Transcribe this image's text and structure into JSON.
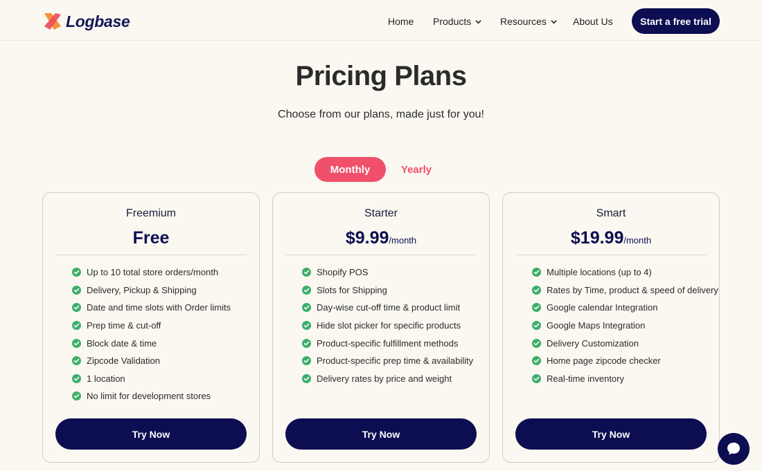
{
  "brand": {
    "name": "Logbase",
    "colors": {
      "logo_orange": "#f7923a",
      "logo_red": "#ee4e5a",
      "navy": "#0d0d52",
      "accent": "#f0506a"
    }
  },
  "nav": {
    "home": "Home",
    "products": "Products",
    "resources": "Resources",
    "about": "About Us",
    "cta": "Start a free trial"
  },
  "hero": {
    "title": "Pricing Plans",
    "subtitle": "Choose from our plans, made just for you!"
  },
  "billing_toggle": {
    "monthly": "Monthly",
    "yearly": "Yearly",
    "selected": "Monthly"
  },
  "plans": [
    {
      "name": "Freemium",
      "price": "Free",
      "period": "",
      "features": [
        "Up to 10 total store orders/month",
        "Delivery, Pickup & Shipping",
        "Date and time slots with Order limits",
        "Prep time & cut-off",
        "Block date & time",
        "Zipcode Validation",
        "1 location",
        "No limit for development stores"
      ],
      "button": "Try Now"
    },
    {
      "name": "Starter",
      "price": "$9.99",
      "period": "/month",
      "features": [
        "Shopify POS",
        "Slots for Shipping",
        "Day-wise cut-off time & product limit",
        "Hide slot picker for specific products",
        "Product-specific fulfillment methods",
        "Product-specific prep time & availability",
        "Delivery rates by price and weight"
      ],
      "button": "Try Now"
    },
    {
      "name": "Smart",
      "price": "$19.99",
      "period": "/month",
      "features": [
        "Multiple locations (up to 4)",
        "Rates by Time, product & speed of delivery",
        "Google calendar Integration",
        "Google Maps Integration",
        "Delivery Customization",
        "Home page zipcode checker",
        "Real-time inventory"
      ],
      "button": "Try Now"
    }
  ],
  "icons": {
    "feature": "check-circle-icon",
    "chat": "chat-bubble-icon",
    "dropdown": "chevron-down-icon"
  }
}
